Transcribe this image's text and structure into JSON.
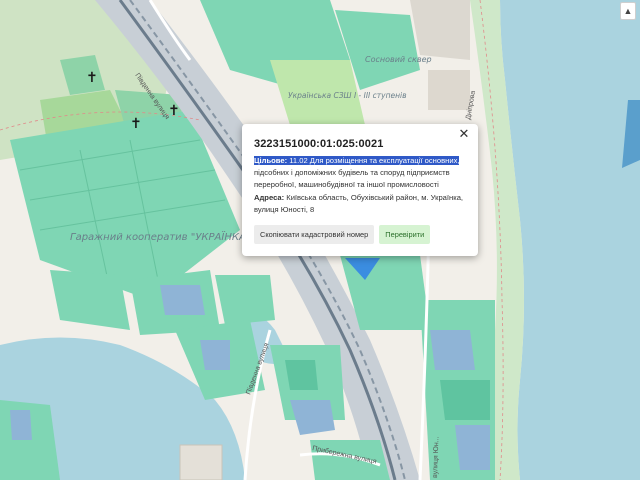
{
  "map": {
    "labels": {
      "park": "Сосновий сквер",
      "school": "Українська СЗШ І - ІІІ ступенів",
      "garage": "Гаражний кооператив \"УКРАЇНКА-1\"",
      "street_pivdenna_top": "Південна вулиця",
      "street_pivdenna_bottom": "Південна вулиця",
      "street_pryberezhna": "Прибережна вулиця",
      "street_dniprova": "Дніпрова",
      "street_yunosti": "вулиця Юн..."
    },
    "colors": {
      "water": "#aad3df",
      "parcel": "#7fd6b4",
      "parcel_dark": "#5fc4a0",
      "parcel_blue": "#8fb4d6",
      "railway": "#8a9aa8",
      "selected_parcel": "#3b8de0"
    }
  },
  "popup": {
    "cadastral_number": "3223151000:01:025:0021",
    "purpose_label": "Цільове:",
    "purpose_text_highlighted": "11.02 Для розміщення та експлуатації основних,",
    "purpose_text_rest": "підсобних і допоміжних будівель та споруд підприємств переробної, машинобудівної та іншої промисловості",
    "address_label": "Адреса:",
    "address_text": "Київська область, Обухівський район, м. Українка, вулиця Юності, 8",
    "copy_button": "Скопіювати кадастровий номер",
    "check_button": "Перевірити",
    "close_icon": "close-icon"
  },
  "controls": {
    "north_icon": "compass-north-icon"
  }
}
